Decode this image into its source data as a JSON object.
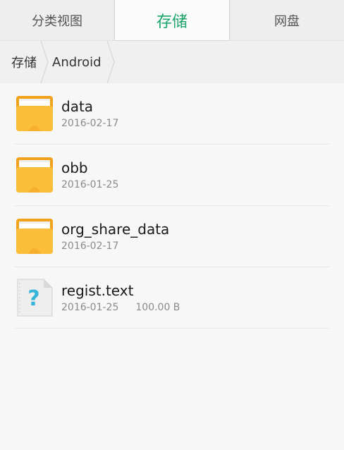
{
  "tabs": [
    {
      "label": "分类视图",
      "active": false
    },
    {
      "label": "存储",
      "active": true
    },
    {
      "label": "网盘",
      "active": false
    }
  ],
  "breadcrumb": [
    "存储",
    "Android"
  ],
  "files": [
    {
      "name": "data",
      "date": "2016-02-17",
      "size": "",
      "type": "folder-icon"
    },
    {
      "name": "obb",
      "date": "2016-01-25",
      "size": "",
      "type": "folder-icon"
    },
    {
      "name": "org_share_data",
      "date": "2016-02-17",
      "size": "",
      "type": "folder-icon"
    },
    {
      "name": "regist.text",
      "date": "2016-01-25",
      "size": "100.00 B",
      "type": "unknown-file-icon"
    }
  ],
  "colors": {
    "accent": "#1aa36b",
    "folder": "#f8b62b",
    "unknown_file_mark": "#35b6d8"
  }
}
